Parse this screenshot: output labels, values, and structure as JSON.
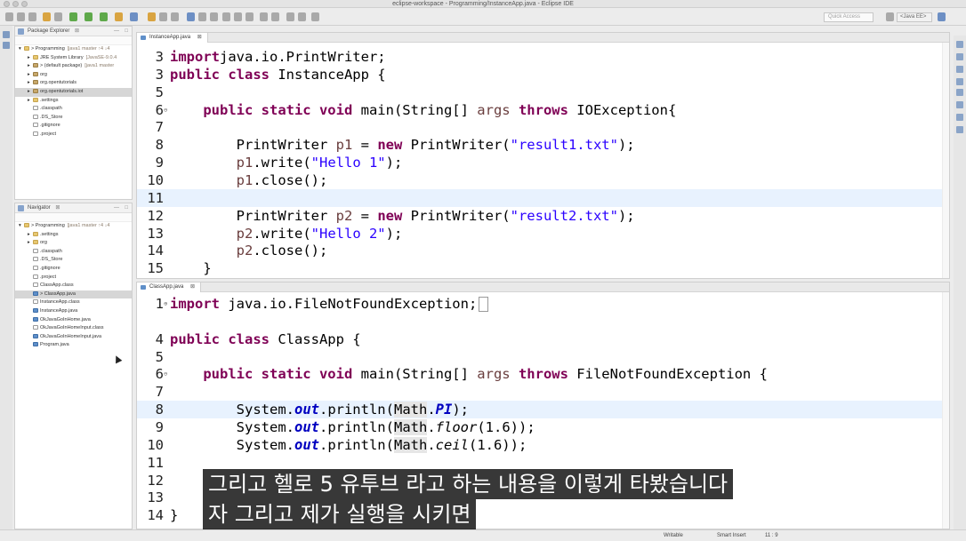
{
  "window": {
    "title": "eclipse-workspace - Programming/InstanceApp.java - Eclipse IDE"
  },
  "toolbar": {
    "quick_access": "Quick Access",
    "perspective": "<Java EE>"
  },
  "package_explorer": {
    "title": "Package Explorer",
    "items": [
      {
        "label": "> Programming",
        "extra": "[java1 master ↑4 ↓4",
        "icon": "folder",
        "indent": 0,
        "expander": "▾"
      },
      {
        "label": "JRE System Library",
        "extra": "[JavaSE-9.0.4",
        "icon": "folder",
        "indent": 1,
        "expander": "▸"
      },
      {
        "label": "> (default package)",
        "extra": "[java1 master",
        "icon": "pkg",
        "indent": 1,
        "expander": "▸"
      },
      {
        "label": "org",
        "extra": "",
        "icon": "pkg",
        "indent": 1,
        "expander": "▸"
      },
      {
        "label": "org.opentutorials",
        "extra": "",
        "icon": "pkg",
        "indent": 1,
        "expander": "▸"
      },
      {
        "label": "org.opentutorials.iot",
        "extra": "",
        "icon": "pkg",
        "indent": 1,
        "expander": "▸",
        "selected": true
      },
      {
        "label": ".settings",
        "extra": "",
        "icon": "folder",
        "indent": 1,
        "expander": "▸"
      },
      {
        "label": ".classpath",
        "extra": "",
        "icon": "file",
        "indent": 1,
        "expander": ""
      },
      {
        "label": ".DS_Store",
        "extra": "",
        "icon": "file",
        "indent": 1,
        "expander": ""
      },
      {
        "label": ".gitignore",
        "extra": "",
        "icon": "file",
        "indent": 1,
        "expander": ""
      },
      {
        "label": ".project",
        "extra": "",
        "icon": "file",
        "indent": 1,
        "expander": ""
      }
    ]
  },
  "navigator": {
    "title": "Navigator",
    "items": [
      {
        "label": "> Programming",
        "extra": "[java1 master ↑4 ↓4",
        "icon": "folder",
        "indent": 0,
        "expander": "▾"
      },
      {
        "label": ".settings",
        "extra": "",
        "icon": "folder",
        "indent": 1,
        "expander": "▸"
      },
      {
        "label": "org",
        "extra": "",
        "icon": "folder",
        "indent": 1,
        "expander": "▸"
      },
      {
        "label": ".classpath",
        "extra": "",
        "icon": "file",
        "indent": 1,
        "expander": ""
      },
      {
        "label": ".DS_Store",
        "extra": "",
        "icon": "file",
        "indent": 1,
        "expander": ""
      },
      {
        "label": ".gitignore",
        "extra": "",
        "icon": "file",
        "indent": 1,
        "expander": ""
      },
      {
        "label": ".project",
        "extra": "",
        "icon": "file",
        "indent": 1,
        "expander": ""
      },
      {
        "label": "ClassApp.class",
        "extra": "",
        "icon": "file",
        "indent": 1,
        "expander": ""
      },
      {
        "label": "> ClassApp.java",
        "extra": "",
        "icon": "java",
        "indent": 1,
        "expander": "",
        "selected": true
      },
      {
        "label": "InstanceApp.class",
        "extra": "",
        "icon": "file",
        "indent": 1,
        "expander": ""
      },
      {
        "label": "InstanceApp.java",
        "extra": "",
        "icon": "java",
        "indent": 1,
        "expander": ""
      },
      {
        "label": "OkJavaGoInHome.java",
        "extra": "",
        "icon": "java",
        "indent": 1,
        "expander": ""
      },
      {
        "label": "OkJavaGoInHomeInput.class",
        "extra": "",
        "icon": "file",
        "indent": 1,
        "expander": ""
      },
      {
        "label": "OkJavaGoInHomeInput.java",
        "extra": "",
        "icon": "java",
        "indent": 1,
        "expander": ""
      },
      {
        "label": "Program.java",
        "extra": "",
        "icon": "java",
        "indent": 1,
        "expander": ""
      }
    ]
  },
  "editor_top": {
    "tab_label": "InstanceApp.java",
    "lines": [
      {
        "n": "3",
        "fold": "",
        "hl": false,
        "tokens": [
          [
            "kw",
            "import"
          ],
          [
            "",
            "java.io.PrintWriter;"
          ]
        ]
      },
      {
        "n": "3",
        "fold": "",
        "hl": false,
        "tokens": [
          [
            "kw",
            "public class"
          ],
          [
            "",
            " InstanceApp {"
          ]
        ]
      },
      {
        "n": "5",
        "fold": "",
        "hl": false,
        "tokens": []
      },
      {
        "n": "6",
        "fold": "⊖",
        "hl": false,
        "tokens": [
          [
            "",
            "    "
          ],
          [
            "kw",
            "public static void"
          ],
          [
            "",
            " main(String[] "
          ],
          [
            "prm",
            "args"
          ],
          [
            "",
            " "
          ],
          [
            "kw",
            "throws"
          ],
          [
            "",
            " IOException{"
          ]
        ]
      },
      {
        "n": "7",
        "fold": "",
        "hl": false,
        "tokens": []
      },
      {
        "n": "8",
        "fold": "",
        "hl": false,
        "tokens": [
          [
            "",
            "        PrintWriter "
          ],
          [
            "prm",
            "p1"
          ],
          [
            "",
            " = "
          ],
          [
            "kw",
            "new"
          ],
          [
            "",
            " PrintWriter("
          ],
          [
            "str",
            "\"result1.txt\""
          ],
          [
            "",
            ");"
          ]
        ]
      },
      {
        "n": "9",
        "fold": "",
        "hl": false,
        "tokens": [
          [
            "",
            "        "
          ],
          [
            "prm",
            "p1"
          ],
          [
            "",
            ".write("
          ],
          [
            "str",
            "\"Hello 1\""
          ],
          [
            "",
            ");"
          ]
        ]
      },
      {
        "n": "10",
        "fold": "",
        "hl": false,
        "tokens": [
          [
            "",
            "        "
          ],
          [
            "prm",
            "p1"
          ],
          [
            "",
            ".close();"
          ]
        ]
      },
      {
        "n": "11",
        "fold": "",
        "hl": true,
        "tokens": []
      },
      {
        "n": "12",
        "fold": "",
        "hl": false,
        "tokens": [
          [
            "",
            "        PrintWriter "
          ],
          [
            "prm",
            "p2"
          ],
          [
            "",
            " = "
          ],
          [
            "kw",
            "new"
          ],
          [
            "",
            " PrintWriter("
          ],
          [
            "str",
            "\"result2.txt\""
          ],
          [
            "",
            ");"
          ]
        ]
      },
      {
        "n": "13",
        "fold": "",
        "hl": false,
        "tokens": [
          [
            "",
            "        "
          ],
          [
            "prm",
            "p2"
          ],
          [
            "",
            ".write("
          ],
          [
            "str",
            "\"Hello 2\""
          ],
          [
            "",
            ");"
          ]
        ]
      },
      {
        "n": "14",
        "fold": "",
        "hl": false,
        "tokens": [
          [
            "",
            "        "
          ],
          [
            "prm",
            "p2"
          ],
          [
            "",
            ".close();"
          ]
        ]
      },
      {
        "n": "15",
        "fold": "",
        "hl": false,
        "tokens": [
          [
            "",
            "    }"
          ]
        ]
      }
    ]
  },
  "editor_bottom": {
    "tab_label": "ClassApp.java",
    "lines": [
      {
        "n": "1",
        "fold": "⊕",
        "hl": false,
        "tokens": [
          [
            "kw",
            "import"
          ],
          [
            "",
            " java.io.FileNotFoundException;"
          ],
          [
            "cursor",
            ""
          ]
        ]
      },
      {
        "n": "",
        "fold": "",
        "hl": false,
        "tokens": []
      },
      {
        "n": "4",
        "fold": "",
        "hl": false,
        "tokens": [
          [
            "kw",
            "public class"
          ],
          [
            "",
            " ClassApp {"
          ]
        ]
      },
      {
        "n": "5",
        "fold": "",
        "hl": false,
        "tokens": []
      },
      {
        "n": "6",
        "fold": "⊖",
        "hl": false,
        "tokens": [
          [
            "",
            "    "
          ],
          [
            "kw",
            "public static void"
          ],
          [
            "",
            " main(String[] "
          ],
          [
            "prm",
            "args"
          ],
          [
            "",
            " "
          ],
          [
            "kw",
            "throws"
          ],
          [
            "",
            " FileNotFoundException {"
          ]
        ]
      },
      {
        "n": "7",
        "fold": "",
        "hl": false,
        "tokens": []
      },
      {
        "n": "8",
        "fold": "",
        "hl": true,
        "tokens": [
          [
            "",
            "        System."
          ],
          [
            "fld",
            "out"
          ],
          [
            "",
            ".println("
          ],
          [
            "ref",
            "Math"
          ],
          [
            "",
            "."
          ],
          [
            "fld",
            "PI"
          ],
          [
            "",
            ");"
          ]
        ]
      },
      {
        "n": "9",
        "fold": "",
        "hl": false,
        "tokens": [
          [
            "",
            "        System."
          ],
          [
            "fld",
            "out"
          ],
          [
            "",
            ".println("
          ],
          [
            "ref",
            "Math"
          ],
          [
            "",
            "."
          ],
          [
            "it",
            "floor"
          ],
          [
            "",
            "(1.6));"
          ]
        ]
      },
      {
        "n": "10",
        "fold": "",
        "hl": false,
        "tokens": [
          [
            "",
            "        System."
          ],
          [
            "fld",
            "out"
          ],
          [
            "",
            ".println("
          ],
          [
            "ref",
            "Math"
          ],
          [
            "",
            "."
          ],
          [
            "it",
            "ceil"
          ],
          [
            "",
            "(1.6));"
          ]
        ]
      },
      {
        "n": "11",
        "fold": "",
        "hl": false,
        "tokens": []
      },
      {
        "n": "12",
        "fold": "",
        "hl": false,
        "tokens": []
      },
      {
        "n": "13",
        "fold": "",
        "hl": false,
        "tokens": []
      },
      {
        "n": "14",
        "fold": "",
        "hl": false,
        "tokens": [
          [
            "",
            "}"
          ]
        ]
      }
    ]
  },
  "subtitle": {
    "line1": "그리고 헬로 5 유투브 라고 하는 내용을 이렇게 타봤습니다",
    "line2": "자 그리고 제가 실행을 시키면"
  },
  "statusbar": {
    "writable": "Writable",
    "insert_mode": "Smart Insert",
    "position": "11 : 9"
  },
  "colors": {
    "keyword": "#7f0055",
    "string": "#2a00ff",
    "field": "#0000c0",
    "current_line": "#e8f2fe"
  }
}
